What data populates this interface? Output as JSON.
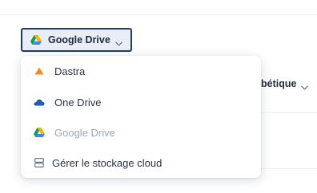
{
  "toolbar": {
    "drive_selector_label": "Google Drive",
    "sort_label_fragment": "bétique"
  },
  "dropdown": {
    "items": [
      {
        "label": "Dastra",
        "icon": "dastra-icon",
        "state": "enabled"
      },
      {
        "label": "One Drive",
        "icon": "onedrive-icon",
        "state": "enabled"
      },
      {
        "label": "Google Drive",
        "icon": "google-drive-icon",
        "state": "selected-disabled"
      },
      {
        "label": "Gérer le stockage cloud",
        "icon": "storage-icon",
        "state": "enabled"
      }
    ]
  },
  "colors": {
    "button_border": "#1f3b63",
    "button_bg": "#e9eef6",
    "dastra_orange": "#f28c28",
    "onedrive_blue": "#1e5bb8",
    "disabled_text": "#98a6bd"
  }
}
